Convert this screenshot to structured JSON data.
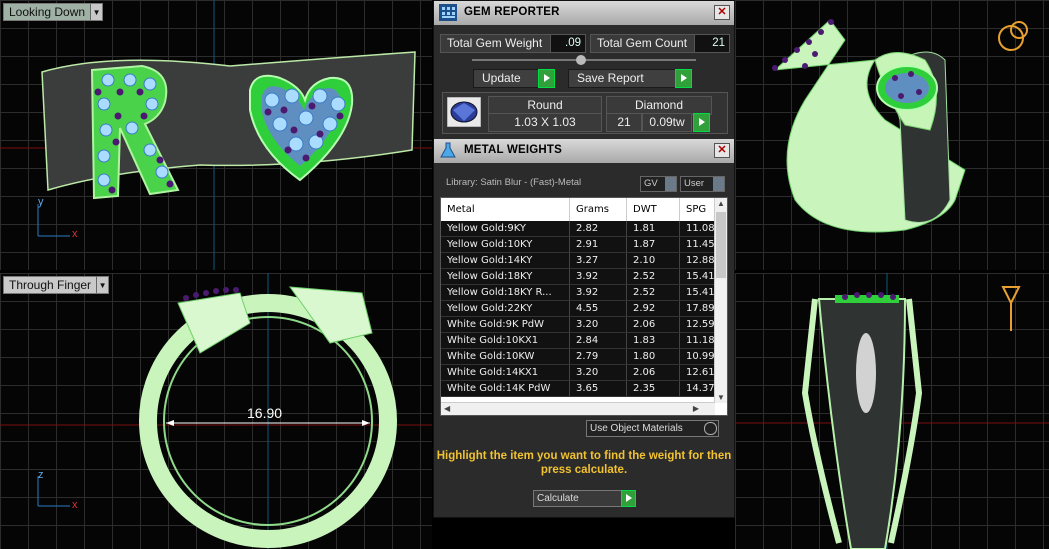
{
  "viewports": {
    "top_left_label": "Looking Down",
    "bottom_left_label": "Through Finger",
    "dimension": "16.90"
  },
  "gem_reporter": {
    "title": "GEM REPORTER",
    "total_weight_label": "Total Gem Weight",
    "total_weight_value": ".09",
    "total_count_label": "Total Gem Count",
    "total_count_value": "21",
    "update_label": "Update",
    "save_report_label": "Save Report",
    "gem": {
      "shape": "Round",
      "type": "Diamond",
      "size": "1.03 X 1.03",
      "count": "21",
      "weight": "0.09tw"
    }
  },
  "metal_weights": {
    "title": "METAL WEIGHTS",
    "library": "Library: Satin Blur - (Fast)-Metal",
    "gv_label": "GV",
    "user_label": "User",
    "columns": [
      "Metal",
      "Grams",
      "DWT",
      "SPG"
    ],
    "rows": [
      [
        "Yellow Gold:9KY",
        "2.82",
        "1.81",
        "11.08"
      ],
      [
        "Yellow Gold:10KY",
        "2.91",
        "1.87",
        "11.45"
      ],
      [
        "Yellow Gold:14KY",
        "3.27",
        "2.10",
        "12.88"
      ],
      [
        "Yellow Gold:18KY",
        "3.92",
        "2.52",
        "15.41"
      ],
      [
        "Yellow Gold:18KY R...",
        "3.92",
        "2.52",
        "15.41"
      ],
      [
        "Yellow Gold:22KY",
        "4.55",
        "2.92",
        "17.89"
      ],
      [
        "White Gold:9K PdW",
        "3.20",
        "2.06",
        "12.59"
      ],
      [
        "White Gold:10KX1",
        "2.84",
        "1.83",
        "11.18"
      ],
      [
        "White Gold:10KW",
        "2.79",
        "1.80",
        "10.99"
      ],
      [
        "White Gold:14KX1",
        "3.20",
        "2.06",
        "12.61"
      ],
      [
        "White Gold:14K PdW",
        "3.65",
        "2.35",
        "14.37"
      ]
    ],
    "use_object_materials": "Use Object Materials",
    "hint": "Highlight the item you want to find the weight for then press calculate.",
    "calculate_label": "Calculate"
  }
}
